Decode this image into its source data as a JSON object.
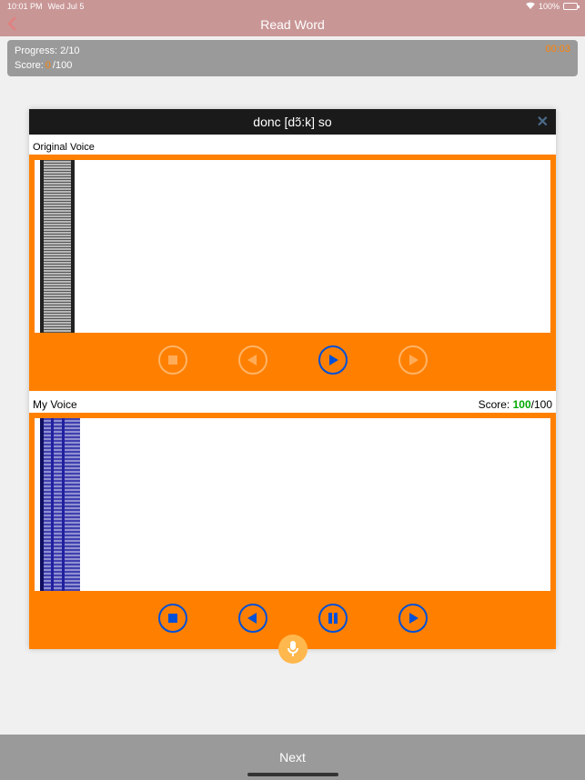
{
  "status": {
    "time": "10:01 PM",
    "date": "Wed Jul 5",
    "battery": "100%"
  },
  "nav": {
    "title": "Read Word"
  },
  "info": {
    "progress_label": "Progress:",
    "progress_value": "2/10",
    "score_label": "Score:",
    "score_value": "0",
    "score_total": "/100",
    "timer": "00:03"
  },
  "card": {
    "title": "donc [dɔ̃:k] so",
    "original_label": "Original Voice",
    "myvoice_label": "My Voice",
    "my_score_label": "Score:",
    "my_score_value": "100",
    "my_score_total": "/100"
  },
  "footer": {
    "next": "Next"
  }
}
